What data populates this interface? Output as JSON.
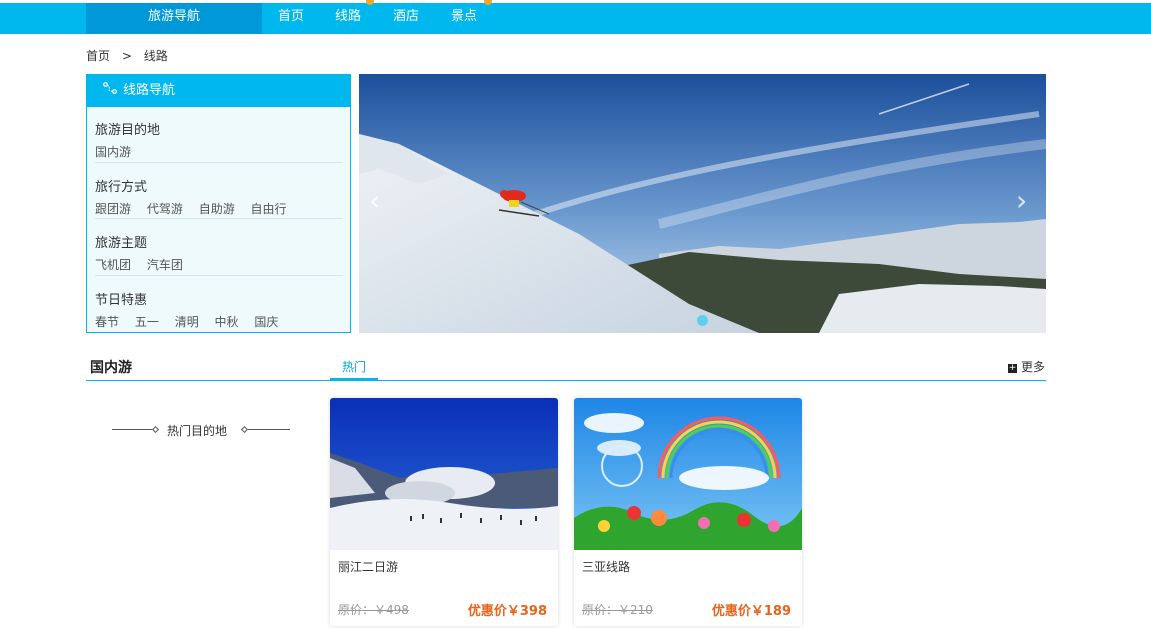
{
  "nav": {
    "brand": "旅游导航",
    "items": [
      "首页",
      "线路",
      "酒店",
      "景点"
    ]
  },
  "breadcrumb": {
    "home": "首页",
    "separator": ">",
    "current": "线路"
  },
  "route_nav": {
    "title": "线路导航",
    "groups": [
      {
        "title": "旅游目的地",
        "links": [
          "国内游"
        ]
      },
      {
        "title": "旅行方式",
        "links": [
          "跟团游",
          "代驾游",
          "自助游",
          "自由行"
        ]
      },
      {
        "title": "旅游主题",
        "links": [
          "飞机团",
          "汽车团"
        ]
      },
      {
        "title": "节日特惠",
        "links": [
          "春节",
          "五一",
          "清明",
          "中秋",
          "国庆"
        ]
      }
    ]
  },
  "banner": {
    "prev": "‹",
    "next": "›"
  },
  "section": {
    "title": "国内游",
    "tab": "热门",
    "more": "更多",
    "more_icon": "+",
    "hot_dest": "热门目的地"
  },
  "cards": [
    {
      "name": "丽江二日游",
      "original": "原价：￥498",
      "price": "优惠价￥398"
    },
    {
      "name": "三亚线路",
      "original": "原价：￥210",
      "price": "优惠价￥189"
    }
  ],
  "colors": {
    "accent": "#00b7ee",
    "brand_bg": "#0098d6",
    "price": "#e8641b"
  }
}
